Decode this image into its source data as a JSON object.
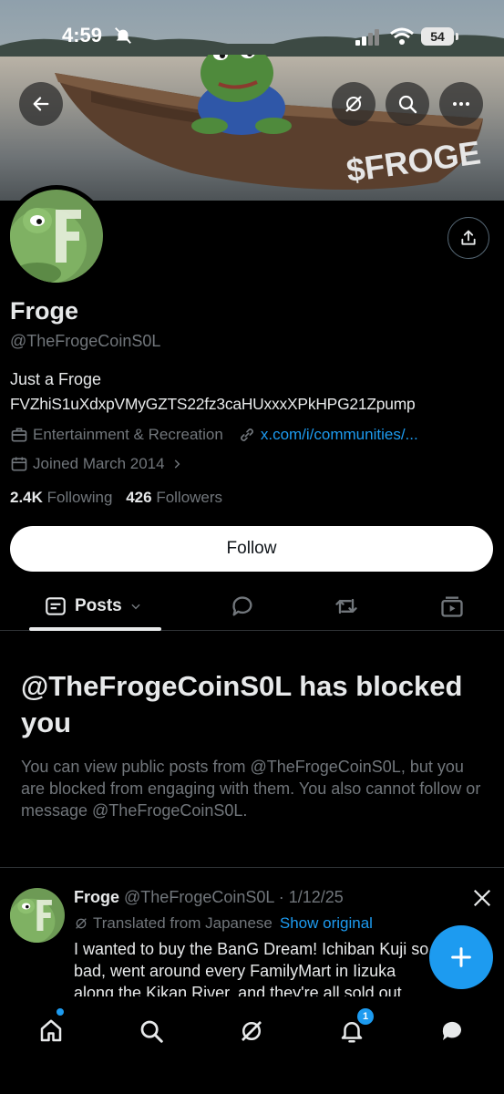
{
  "status_bar": {
    "time": "4:59",
    "battery": "54"
  },
  "banner": {
    "boat_text": "$FROGE"
  },
  "profile": {
    "name": "Froge",
    "handle": "@TheFrogeCoinS0L",
    "bio_line1": "Just a Froge",
    "bio_line2": "FVZhiS1uXdxpVMyGZTS22fz3caHUxxxXPkHPG21Zpump",
    "category": "Entertainment & Recreation",
    "link": "x.com/i/communities/...",
    "joined": "Joined March 2014",
    "following_count": "2.4K",
    "following_label": "Following",
    "followers_count": "426",
    "followers_label": "Followers",
    "follow_button": "Follow"
  },
  "tabs": {
    "posts_label": "Posts"
  },
  "blocked": {
    "title": "@TheFrogeCoinS0L has blocked you",
    "body": "You can view public posts from @TheFrogeCoinS0L, but you are blocked from engaging with them. You also cannot follow or message @TheFrogeCoinS0L."
  },
  "post": {
    "author": "Froge",
    "handle_date": "@TheFrogeCoinS0L · 1/12/25",
    "translated_label": "Translated from Japanese",
    "show_original": "Show original",
    "text": "I wanted to buy the BanG Dream! Ichiban Kuji so bad, went around every FamilyMart in Iizuka along the Kikan River, and they're all sold out"
  },
  "bottom_nav": {
    "notification_count": "1"
  },
  "colors": {
    "accent": "#1d9bf0",
    "background": "#000000",
    "secondary_text": "#71767b",
    "primary_text": "#e7e9ea"
  }
}
